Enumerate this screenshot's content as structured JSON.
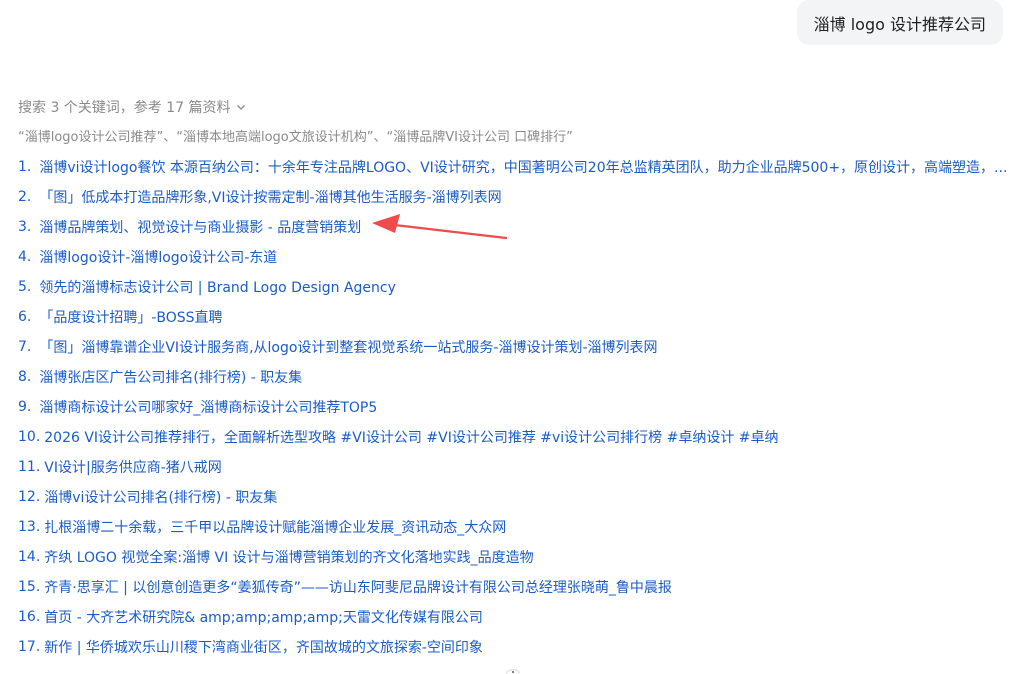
{
  "query": "淄博 logo 设计推荐公司",
  "search_summary": "搜索 3 个关键词，参考 17 篇资料",
  "keywords": "“淄博logo设计公司推荐”、“淄博本地高端logo文旅设计机构”、“淄博品牌VI设计公司 口碑排行”",
  "results": [
    {
      "num": "1.",
      "title": "淄博vi设计logo餐饮 本源百纳公司：十余年专注品牌LOGO、VI设计研究，中国著明公司20年总监精英团队，助力企业品牌500+，原创设计，高端塑造，..."
    },
    {
      "num": "2.",
      "title": "「图」低成本打造品牌形象,VI设计按需定制-淄博其他生活服务-淄博列表网"
    },
    {
      "num": "3.",
      "title": "淄博品牌策划、视觉设计与商业摄影 - 品度营销策划"
    },
    {
      "num": "4.",
      "title": "淄博logo设计-淄博logo设计公司-东道"
    },
    {
      "num": "5.",
      "title": "领先的淄博标志设计公司 | Brand Logo Design Agency"
    },
    {
      "num": "6.",
      "title": "「品度设计招聘」-BOSS直聘"
    },
    {
      "num": "7.",
      "title": "「图」淄博靠谱企业VI设计服务商,从logo设计到整套视觉系统一站式服务-淄博设计策划-淄博列表网"
    },
    {
      "num": "8.",
      "title": "淄博张店区广告公司排名(排行榜) - 职友集"
    },
    {
      "num": "9.",
      "title": "淄博商标设计公司哪家好_淄博商标设计公司推荐TOP5"
    },
    {
      "num": "10.",
      "title": "2026 VI设计公司推荐排行，全面解析选型攻略 #VI设计公司 #VI设计公司推荐 #vi设计公司排行榜 #卓纳设计 #卓纳"
    },
    {
      "num": "11.",
      "title": "VI设计|服务供应商-猪八戒网"
    },
    {
      "num": "12.",
      "title": "淄博vi设计公司排名(排行榜) - 职友集"
    },
    {
      "num": "13.",
      "title": "扎根淄博二十余载，三千甲以品牌设计赋能淄博企业发展_资讯动态_大众网"
    },
    {
      "num": "14.",
      "title": "齐纨 LOGO 视觉全案:淄博 VI 设计与淄博营销策划的齐文化落地实践_品度造物"
    },
    {
      "num": "15.",
      "title": "齐青·思享汇 | 以创意创造更多“姜狐传奇”——访山东阿斐尼品牌设计有限公司总经理张晓萌_鲁中晨报"
    },
    {
      "num": "16.",
      "title": "首页 - 大齐艺术研究院& amp;amp;amp;amp;天雷文化传媒有限公司"
    },
    {
      "num": "17.",
      "title": "新作 | 华侨城欢乐山川稷下湾商业街区，齐国故城的文旅探索-空间印象"
    }
  ],
  "colors": {
    "link": "#1a5cc8",
    "muted": "#8a8a8a",
    "bubble_bg": "#f3f4f6",
    "arrow": "#f04b4b"
  },
  "icons": {
    "expand": "chevron-down-icon",
    "annotation": "red-arrow-annotation"
  }
}
